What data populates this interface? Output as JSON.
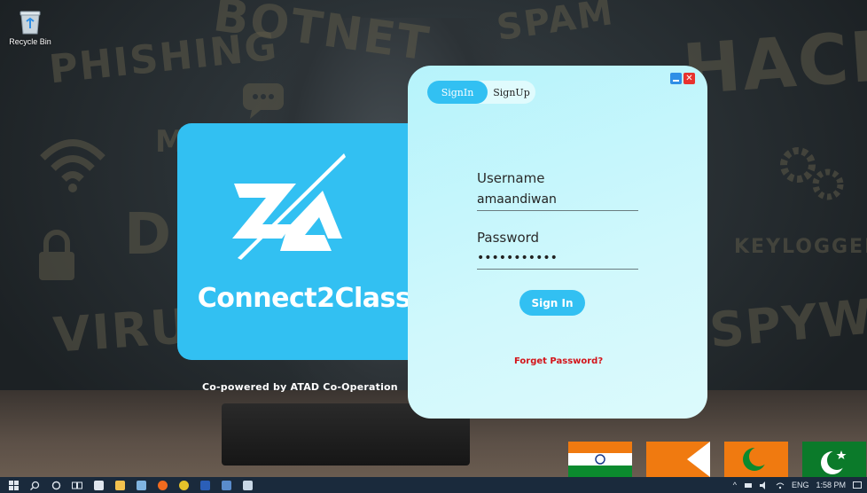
{
  "desktop": {
    "background_words": [
      "PHISHING",
      "BOTNET",
      "SPAM",
      "HACKER",
      "KEYLOGGER",
      "VIRUS",
      "SPYWARE",
      "DE",
      "M"
    ],
    "recycle_bin_label": "Recycle Bin"
  },
  "brand": {
    "title": "Connect2Class",
    "copowered": "Co-powered by ATAD Co-Operation",
    "accent_color": "#32c0f2"
  },
  "login": {
    "tabs": [
      {
        "label": "SignIn",
        "active": true
      },
      {
        "label": "SignUp",
        "active": false
      }
    ],
    "username_label": "Username",
    "username_value": "amaandiwan",
    "password_label": "Password",
    "password_value": "•••••••••••",
    "signin_button": "Sign In",
    "forget_password": "Forget Password?",
    "close_glyph": "✕"
  },
  "taskbar": {
    "search_icon": "search-icon",
    "tray": {
      "language": "ENG",
      "time": "1:58 PM"
    }
  }
}
